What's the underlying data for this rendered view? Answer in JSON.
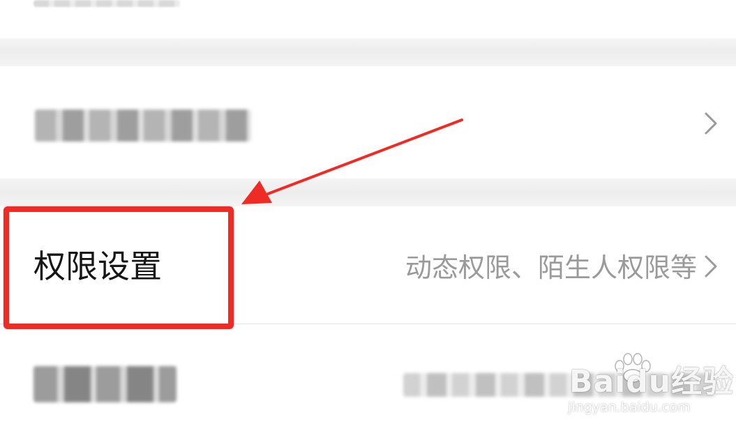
{
  "settings": {
    "permissions_row": {
      "label": "权限设置",
      "value": "动态权限、陌生人权限等"
    }
  },
  "icons": {
    "row_chevron": "chevron-right-icon"
  },
  "annotation": {
    "highlight_color": "#ee2b24"
  },
  "watermark": {
    "brand": "Baidu经验",
    "url": "jingyan.baidu.com"
  }
}
